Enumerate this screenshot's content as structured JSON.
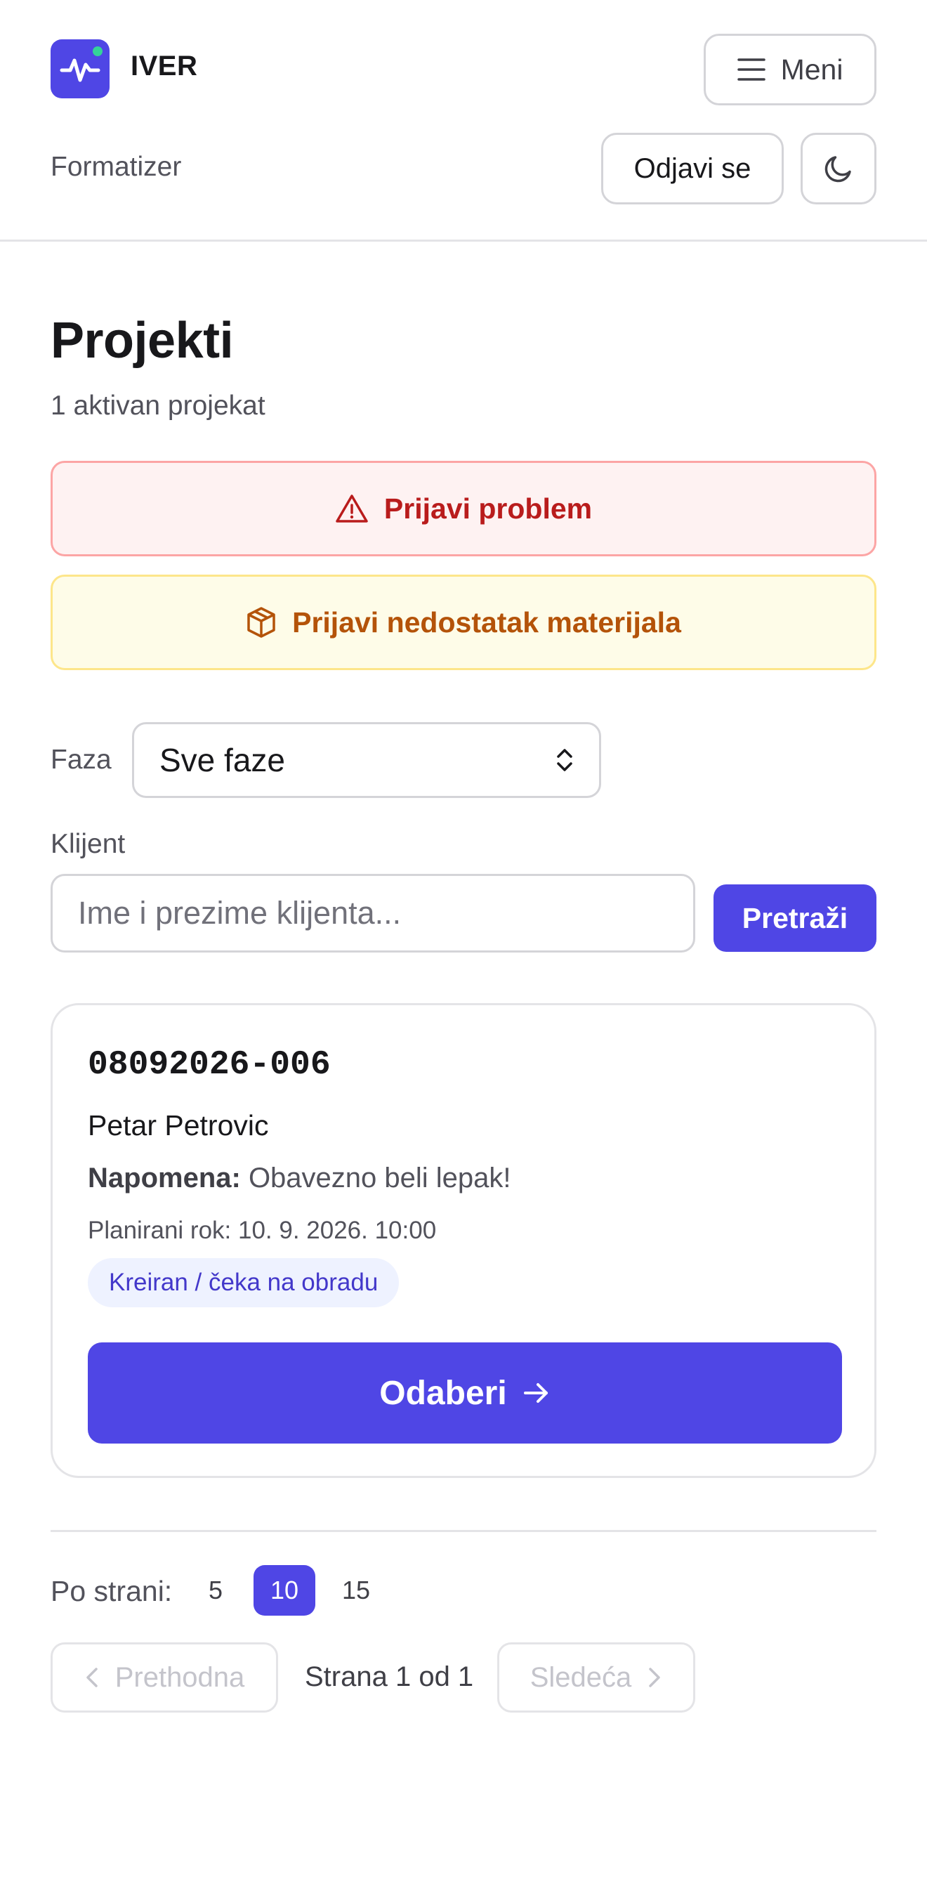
{
  "header": {
    "brand": "IVER",
    "menu_label": "Meni",
    "app_subtitle": "Formatizer",
    "logout_label": "Odjavi se"
  },
  "page": {
    "title": "Projekti",
    "subtitle": "1 aktivan projekat"
  },
  "actions": {
    "report_problem": "Prijavi problem",
    "report_material": "Prijavi nedostatak materijala"
  },
  "filters": {
    "phase_label": "Faza",
    "phase_selected": "Sve faze",
    "client_label": "Klijent",
    "client_value": "",
    "client_placeholder": "Ime i prezime klijenta...",
    "search_label": "Pretraži"
  },
  "projects": [
    {
      "code": "08092026-006",
      "client": "Petar Petrovic",
      "note_label": "Napomena:",
      "note": "Obavezno beli lepak!",
      "deadline": "Planirani rok: 10. 9. 2026. 10:00",
      "status": "Kreiran / čeka na obradu",
      "select_label": "Odaberi"
    }
  ],
  "pagination": {
    "per_page_label": "Po strani:",
    "per_page_options": [
      "5",
      "10",
      "15"
    ],
    "per_page_selected": "10",
    "prev_label": "Prethodna",
    "next_label": "Sledeća",
    "page_info": "Strana 1 od 1"
  },
  "colors": {
    "accent": "#4f46e5",
    "danger_bg": "#fef2f2",
    "danger_text": "#b91c1c",
    "warning_bg": "#fefce8",
    "warning_text": "#b45309",
    "badge_bg": "#eef2ff",
    "badge_text": "#4338ca"
  },
  "icons": {
    "logo": "activity-pulse-icon",
    "menu": "hamburger-icon",
    "theme": "moon-icon",
    "problem": "warning-triangle-icon",
    "material": "package-box-icon",
    "select": "chevron-up-down-icon",
    "select_arrow": "arrow-right-icon",
    "prev": "chevron-left-icon",
    "next": "chevron-right-icon"
  }
}
